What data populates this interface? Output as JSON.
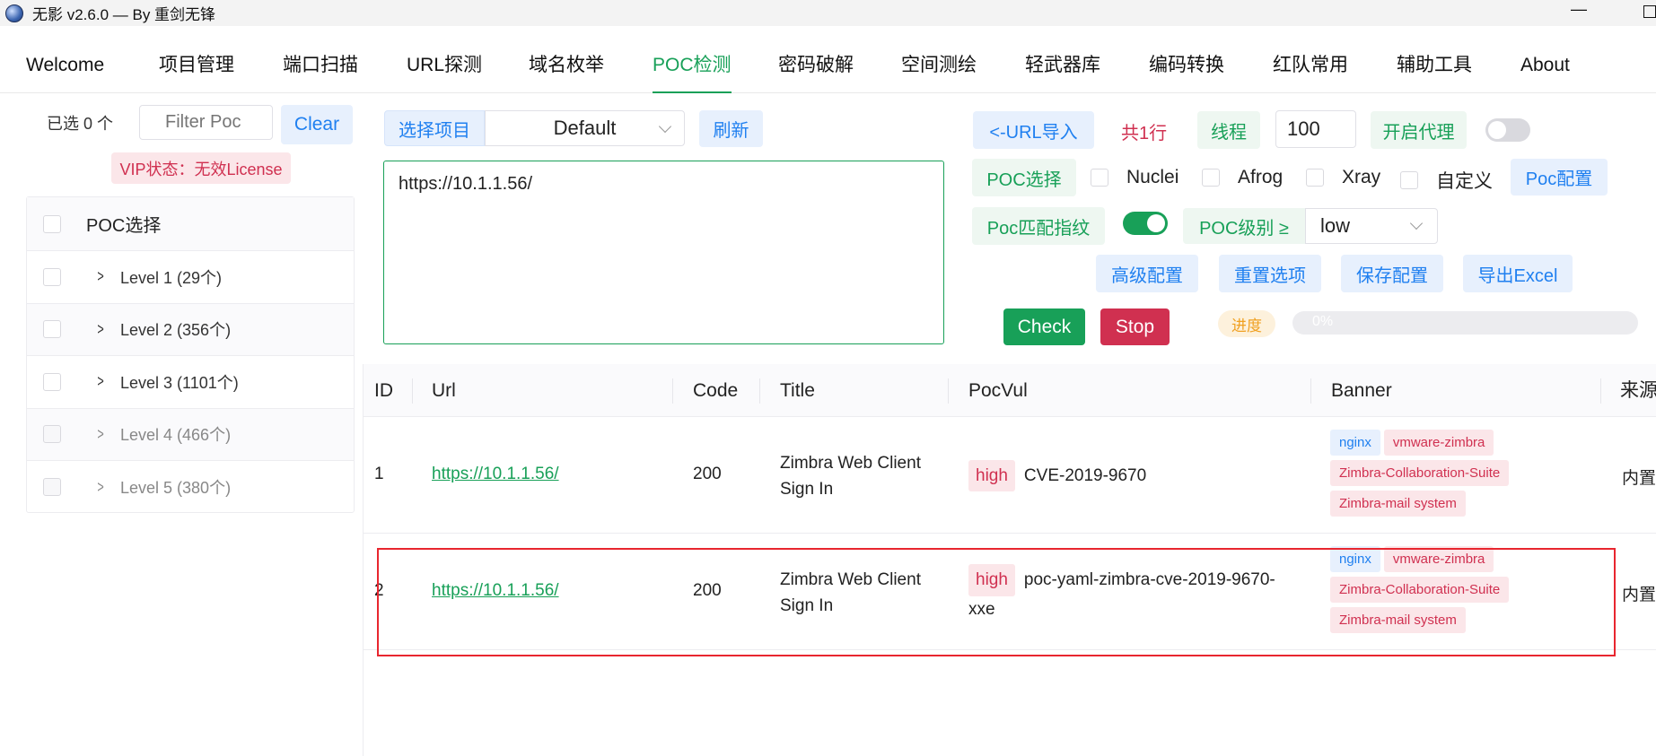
{
  "window": {
    "title": "无影 v2.6.0 — By 重剑无锋",
    "minimize": "—"
  },
  "menu": [
    "Welcome",
    "项目管理",
    "端口扫描",
    "URL探测",
    "域名枚举",
    "POC检测",
    "密码破解",
    "空间测绘",
    "轻武器库",
    "编码转换",
    "红队常用",
    "辅助工具",
    "About"
  ],
  "left": {
    "selected_count": "已选 0 个",
    "filter_placeholder": "Filter Poc",
    "clear": "Clear",
    "vip": "VIP状态：无效License",
    "tree_header": "POC选择",
    "levels": [
      "Level 1 (29个)",
      "Level 2 (356个)",
      "Level 3 (1101个)",
      "Level 4 (466个)",
      "Level 5 (380个)"
    ]
  },
  "center": {
    "project_label": "选择项目",
    "project_value": "Default",
    "refresh": "刷新",
    "url_text": "https://10.1.1.56/"
  },
  "right": {
    "url_import": "<-URL导入",
    "line_count": "共1行",
    "thread_label": "线程",
    "thread_value": "100",
    "proxy_label": "开启代理",
    "poc_select_label": "POC选择",
    "engines": [
      "Nuclei",
      "Afrog",
      "Xray",
      "自定义"
    ],
    "poc_config": "Poc配置",
    "fingerprint_label": "Poc匹配指纹",
    "level_label": "POC级别 ≥",
    "level_value": "low",
    "advanced": "高级配置",
    "reset": "重置选项",
    "save": "保存配置",
    "export": "导出Excel",
    "check": "Check",
    "stop": "Stop",
    "progress_label": "进度",
    "progress_text": "0%",
    "progress_value": 0,
    "proxy_on": false,
    "fingerprint_on": true
  },
  "table": {
    "headers": [
      "ID",
      "Url",
      "Code",
      "Title",
      "PocVul",
      "Banner",
      "来源"
    ],
    "rows": [
      {
        "id": "1",
        "url": "https://10.1.1.56/",
        "code": "200",
        "title": "Zimbra Web Client Sign In",
        "severity": "high",
        "vul": "CVE-2019-9670",
        "banners": [
          "nginx",
          "vmware-zimbra",
          "Zimbra-Collaboration-Suite",
          "Zimbra-mail system"
        ],
        "source": "内置"
      },
      {
        "id": "2",
        "url": "https://10.1.1.56/",
        "code": "200",
        "title": "Zimbra Web Client Sign In",
        "severity": "high",
        "vul": "poc-yaml-zimbra-cve-2019-9670-xxe",
        "banners": [
          "nginx",
          "vmware-zimbra",
          "Zimbra-Collaboration-Suite",
          "Zimbra-mail system"
        ],
        "source": "内置"
      }
    ]
  },
  "colors": {
    "accent": "#18a058",
    "primary": "#2080f0",
    "danger": "#d03050",
    "warning": "#f0a020",
    "highlight_box": "#e8262f"
  }
}
